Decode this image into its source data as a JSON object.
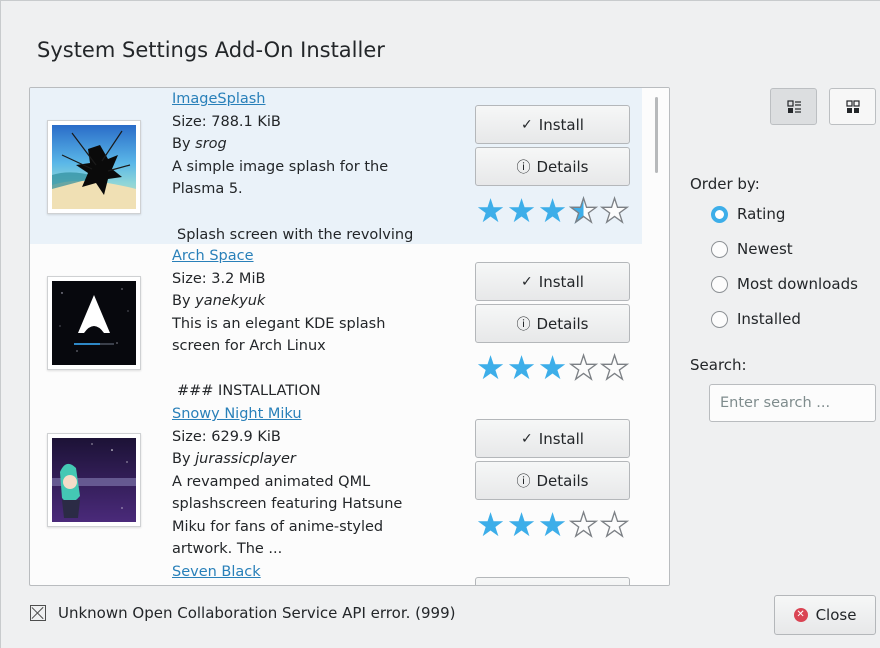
{
  "window": {
    "title": "System Settings Add-On Installer"
  },
  "items": [
    {
      "name": "ImageSplash",
      "size": "Size: 788.1 KiB",
      "by_prefix": "By ",
      "author": "srog",
      "description_lines": [
        "A simple image splash for the",
        "Plasma 5."
      ],
      "rating_stars": 3.5,
      "install_label": "Install",
      "details_label": "Details"
    },
    {
      "name": "Arch Space",
      "size": "Size: 3.2 MiB",
      "by_prefix": "By ",
      "author": "yanekyuk",
      "description_lines": [
        "This is an elegant KDE splash",
        "screen for Arch Linux"
      ],
      "rating_stars": 3,
      "install_label": "Install",
      "details_label": "Details"
    },
    {
      "name": "Snowy Night Miku",
      "size": "Size: 629.9 KiB",
      "by_prefix": "By ",
      "author": "jurassicplayer",
      "description_lines": [
        "A revamped animated QML",
        "splashscreen featuring Hatsune",
        "Miku for fans of anime-styled",
        "artwork. The ..."
      ],
      "rating_stars": 3,
      "install_label": "Install",
      "details_label": "Details"
    },
    {
      "name": "Seven Black"
    }
  ],
  "overflow_texts": [
    " Splash screen with the revolving",
    " ### INSTALLATION"
  ],
  "sidebar": {
    "order_by_label": "Order by:",
    "order_options": [
      {
        "label": "Rating",
        "checked": true
      },
      {
        "label": "Newest",
        "checked": false
      },
      {
        "label": "Most downloads",
        "checked": false
      },
      {
        "label": "Installed",
        "checked": false
      }
    ],
    "search_label": "Search:",
    "search_placeholder": "Enter search ...",
    "search_value": ""
  },
  "status": {
    "message": "Unknown Open Collaboration Service API error. (999)"
  },
  "close_label": "Close",
  "icons": {
    "check": "✓",
    "info": "ⓘ",
    "star": "★"
  },
  "colors": {
    "accent": "#3daee9",
    "link": "#2980b9",
    "close": "#da4453"
  }
}
